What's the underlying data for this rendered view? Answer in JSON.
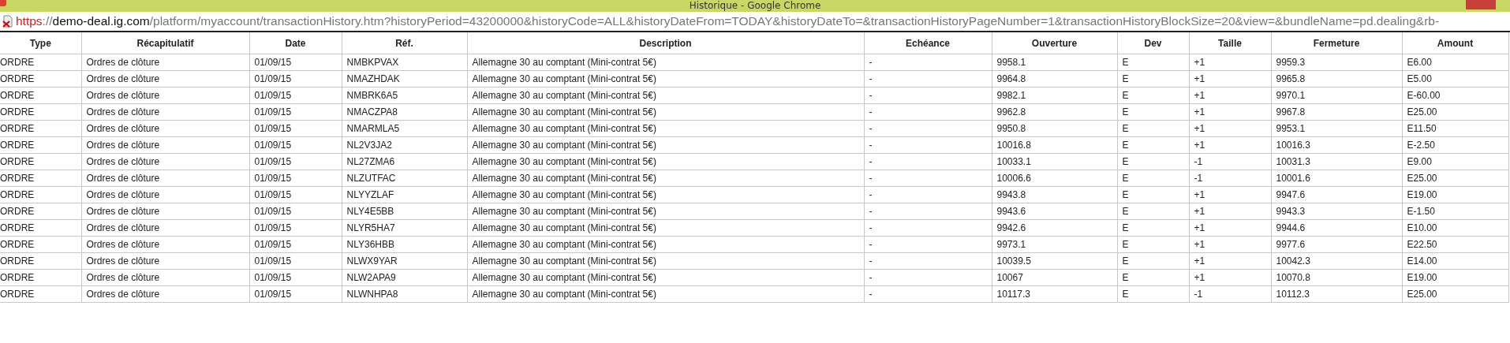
{
  "window": {
    "title": "Historique - Google Chrome"
  },
  "address_bar": {
    "scheme": "https",
    "separator": "://",
    "host": "demo-deal.ig.com",
    "path": "/platform/myaccount/transactionHistory.htm?historyPeriod=43200000&historyCode=ALL&historyDateFrom=TODAY&historyDateTo=&transactionHistoryPageNumber=1&transactionHistoryBlockSize=20&view=&bundleName=pd.dealing&rb-"
  },
  "table": {
    "columns": [
      "Type",
      "Récapitulatif",
      "Date",
      "Réf.",
      "Description",
      "Echéance",
      "Ouverture",
      "Dev",
      "Taille",
      "Fermeture",
      "Amount"
    ],
    "rows": [
      [
        "ORDRE",
        "Ordres de clôture",
        "01/09/15",
        "NMBKPVAX",
        "Allemagne 30 au comptant (Mini-contrat 5€)",
        "-",
        "9958.1",
        "E",
        "+1",
        "9959.3",
        "E6.00"
      ],
      [
        "ORDRE",
        "Ordres de clôture",
        "01/09/15",
        "NMAZHDAK",
        "Allemagne 30 au comptant (Mini-contrat 5€)",
        "-",
        "9964.8",
        "E",
        "+1",
        "9965.8",
        "E5.00"
      ],
      [
        "ORDRE",
        "Ordres de clôture",
        "01/09/15",
        "NMBRK6A5",
        "Allemagne 30 au comptant (Mini-contrat 5€)",
        "-",
        "9982.1",
        "E",
        "+1",
        "9970.1",
        "E-60.00"
      ],
      [
        "ORDRE",
        "Ordres de clôture",
        "01/09/15",
        "NMACZPA8",
        "Allemagne 30 au comptant (Mini-contrat 5€)",
        "-",
        "9962.8",
        "E",
        "+1",
        "9967.8",
        "E25.00"
      ],
      [
        "ORDRE",
        "Ordres de clôture",
        "01/09/15",
        "NMARMLA5",
        "Allemagne 30 au comptant (Mini-contrat 5€)",
        "-",
        "9950.8",
        "E",
        "+1",
        "9953.1",
        "E11.50"
      ],
      [
        "ORDRE",
        "Ordres de clôture",
        "01/09/15",
        "NL2V3JA2",
        "Allemagne 30 au comptant (Mini-contrat 5€)",
        "-",
        "10016.8",
        "E",
        "+1",
        "10016.3",
        "E-2.50"
      ],
      [
        "ORDRE",
        "Ordres de clôture",
        "01/09/15",
        "NL27ZMA6",
        "Allemagne 30 au comptant (Mini-contrat 5€)",
        "-",
        "10033.1",
        "E",
        "-1",
        "10031.3",
        "E9.00"
      ],
      [
        "ORDRE",
        "Ordres de clôture",
        "01/09/15",
        "NLZUTFAC",
        "Allemagne 30 au comptant (Mini-contrat 5€)",
        "-",
        "10006.6",
        "E",
        "-1",
        "10001.6",
        "E25.00"
      ],
      [
        "ORDRE",
        "Ordres de clôture",
        "01/09/15",
        "NLYYZLAF",
        "Allemagne 30 au comptant (Mini-contrat 5€)",
        "-",
        "9943.8",
        "E",
        "+1",
        "9947.6",
        "E19.00"
      ],
      [
        "ORDRE",
        "Ordres de clôture",
        "01/09/15",
        "NLY4E5BB",
        "Allemagne 30 au comptant (Mini-contrat 5€)",
        "-",
        "9943.6",
        "E",
        "+1",
        "9943.3",
        "E-1.50"
      ],
      [
        "ORDRE",
        "Ordres de clôture",
        "01/09/15",
        "NLYR5HA7",
        "Allemagne 30 au comptant (Mini-contrat 5€)",
        "-",
        "9942.6",
        "E",
        "+1",
        "9944.6",
        "E10.00"
      ],
      [
        "ORDRE",
        "Ordres de clôture",
        "01/09/15",
        "NLY36HBB",
        "Allemagne 30 au comptant (Mini-contrat 5€)",
        "-",
        "9973.1",
        "E",
        "+1",
        "9977.6",
        "E22.50"
      ],
      [
        "ORDRE",
        "Ordres de clôture",
        "01/09/15",
        "NLWX9YAR",
        "Allemagne 30 au comptant (Mini-contrat 5€)",
        "-",
        "10039.5",
        "E",
        "+1",
        "10042.3",
        "E14.00"
      ],
      [
        "ORDRE",
        "Ordres de clôture",
        "01/09/15",
        "NLW2APA9",
        "Allemagne 30 au comptant (Mini-contrat 5€)",
        "-",
        "10067",
        "E",
        "+1",
        "10070.8",
        "E19.00"
      ],
      [
        "ORDRE",
        "Ordres de clôture",
        "01/09/15",
        "NLWNHPA8",
        "Allemagne 30 au comptant (Mini-contrat 5€)",
        "-",
        "10117.3",
        "E",
        "-1",
        "10112.3",
        "E25.00"
      ]
    ]
  }
}
